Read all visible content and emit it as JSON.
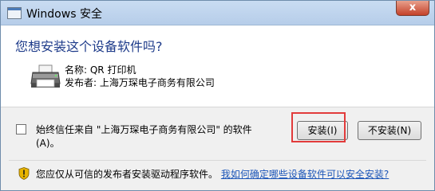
{
  "window": {
    "title": "Windows 安全",
    "close_label": "x"
  },
  "question": "您想安装这个设备软件吗?",
  "device": {
    "name_label": "名称: QR 打印机",
    "publisher_label": "发布者: 上海万琛电子商务有限公司"
  },
  "trust_option": {
    "label": "始终信任来自 \"上海万琛电子商务有限公司\" 的软件 (A)。",
    "checked": false
  },
  "buttons": {
    "install": "安装(I)",
    "dont_install": "不安装(N)"
  },
  "warning": {
    "text": "您应仅从可信的发布者安装驱动程序软件。",
    "link": "我如何确定哪些设备软件可以安全安装?"
  }
}
